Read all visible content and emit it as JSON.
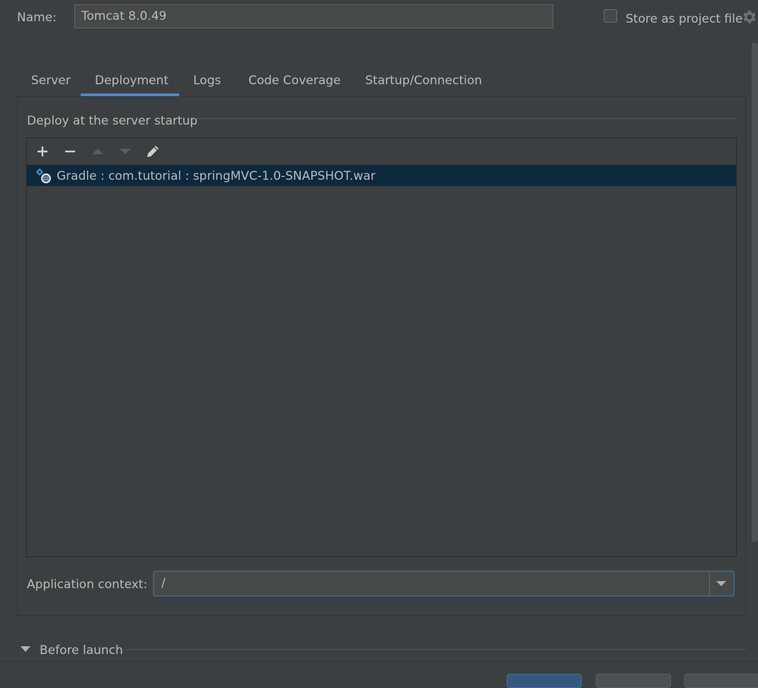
{
  "name_field": {
    "label": "Name:",
    "value": "Tomcat 8.0.49"
  },
  "store_option": {
    "label": "Store as project file",
    "checked": false,
    "gear_icon": "gear-icon"
  },
  "tabs": [
    {
      "label": "Server",
      "selected": false
    },
    {
      "label": "Deployment",
      "selected": true
    },
    {
      "label": "Logs",
      "selected": false
    },
    {
      "label": "Code Coverage",
      "selected": false
    },
    {
      "label": "Startup/Connection",
      "selected": false
    }
  ],
  "deploy": {
    "title": "Deploy at the server startup",
    "toolbar": {
      "icons": [
        "plus-icon",
        "minus-icon",
        "arrow-up-icon",
        "arrow-down-icon",
        "pencil-icon"
      ]
    },
    "items": [
      {
        "icon": "gradle-artifact-icon",
        "label": "Gradle : com.tutorial : springMVC-1.0-SNAPSHOT.war",
        "selected": true
      }
    ]
  },
  "app_context": {
    "label": "Application context:",
    "value": "/"
  },
  "before_launch": {
    "label": "Before launch",
    "collapsed": false
  },
  "colors": {
    "background": "#3c3f41",
    "accent": "#4a88c7",
    "selection": "#0d293e",
    "text": "#bbbbbb"
  }
}
